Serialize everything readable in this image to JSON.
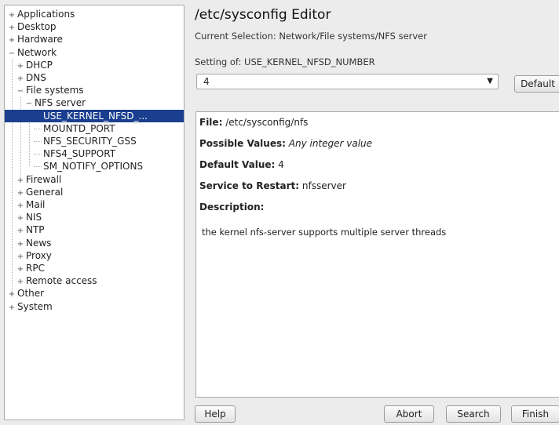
{
  "tree": {
    "nodes": [
      {
        "label": "Applications",
        "expander": "+",
        "indent": 0
      },
      {
        "label": "Desktop",
        "expander": "+",
        "indent": 0
      },
      {
        "label": "Hardware",
        "expander": "+",
        "indent": 0
      },
      {
        "label": "Network",
        "expander": "−",
        "indent": 0
      },
      {
        "label": "DHCP",
        "expander": "+",
        "indent": 1
      },
      {
        "label": "DNS",
        "expander": "+",
        "indent": 1
      },
      {
        "label": "File systems",
        "expander": "−",
        "indent": 1
      },
      {
        "label": "NFS server",
        "expander": "−",
        "indent": 2
      },
      {
        "label": "USE_KERNEL_NFSD_...",
        "expander": "",
        "indent": 3,
        "selected": true
      },
      {
        "label": "MOUNTD_PORT",
        "expander": "",
        "indent": 3
      },
      {
        "label": "NFS_SECURITY_GSS",
        "expander": "",
        "indent": 3
      },
      {
        "label": "NFS4_SUPPORT",
        "expander": "",
        "indent": 3
      },
      {
        "label": "SM_NOTIFY_OPTIONS",
        "expander": "",
        "indent": 3
      },
      {
        "label": "Firewall",
        "expander": "+",
        "indent": 1
      },
      {
        "label": "General",
        "expander": "+",
        "indent": 1
      },
      {
        "label": "Mail",
        "expander": "+",
        "indent": 1
      },
      {
        "label": "NIS",
        "expander": "+",
        "indent": 1
      },
      {
        "label": "NTP",
        "expander": "+",
        "indent": 1
      },
      {
        "label": "News",
        "expander": "+",
        "indent": 1
      },
      {
        "label": "Proxy",
        "expander": "+",
        "indent": 1
      },
      {
        "label": "RPC",
        "expander": "+",
        "indent": 1
      },
      {
        "label": "Remote access",
        "expander": "+",
        "indent": 1
      },
      {
        "label": "Other",
        "expander": "+",
        "indent": 0
      },
      {
        "label": "System",
        "expander": "+",
        "indent": 0
      }
    ]
  },
  "header": {
    "title": "/etc/sysconfig Editor",
    "current_selection": "Current Selection: Network/File systems/NFS server"
  },
  "setting": {
    "label": "Setting of: USE_KERNEL_NFSD_NUMBER",
    "value": "4",
    "default_button": "Default"
  },
  "info": {
    "file_label": "File:",
    "file_value": "/etc/sysconfig/nfs",
    "possible_label": "Possible Values:",
    "possible_value": "Any integer value",
    "default_label": "Default Value:",
    "default_value": "4",
    "service_label": "Service to Restart:",
    "service_value": "nfsserver",
    "description_label": "Description:",
    "description_text": "the kernel nfs-server supports multiple server threads"
  },
  "buttons": {
    "help": "Help",
    "abort": "Abort",
    "search": "Search",
    "finish": "Finish"
  },
  "colors": {
    "selection": "#1b3f8f",
    "background": "#ececec"
  }
}
